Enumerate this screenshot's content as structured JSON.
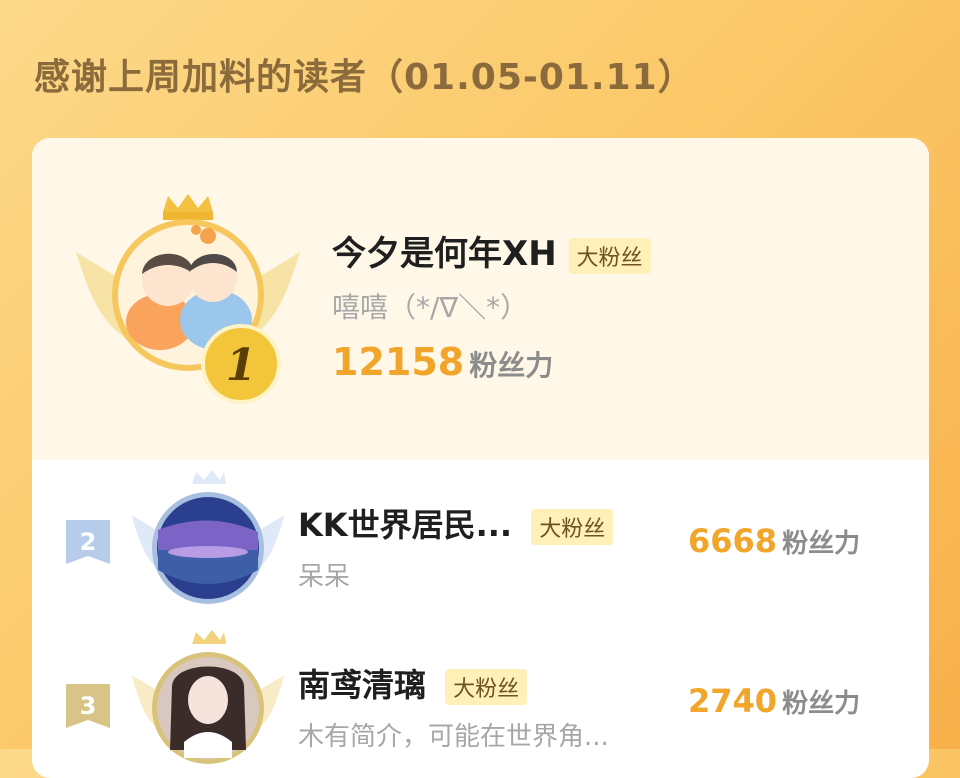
{
  "title": "感谢上周加料的读者（01.05-01.11）",
  "badge_label": "大粉丝",
  "fan_power_unit": "粉丝力",
  "readers": [
    {
      "rank": "1",
      "name": "今夕是何年XH",
      "bio": "嘻嘻（*/∇＼*）",
      "score": "12158"
    },
    {
      "rank": "2",
      "name": "KK世界居民...",
      "bio": "呆呆",
      "score": "6668"
    },
    {
      "rank": "3",
      "name": "南鸢清璃",
      "bio": "木有简介，可能在世界角...",
      "score": "2740"
    }
  ],
  "colors": {
    "accent": "#f1a52a",
    "gold": "#f5c542",
    "silver": "#a9bfe0",
    "bronze": "#c9b06a"
  },
  "icons": [
    "crown-icon",
    "wings-icon",
    "rank-1-medal-icon",
    "rank-2-ribbon-icon",
    "rank-3-ribbon-icon"
  ]
}
